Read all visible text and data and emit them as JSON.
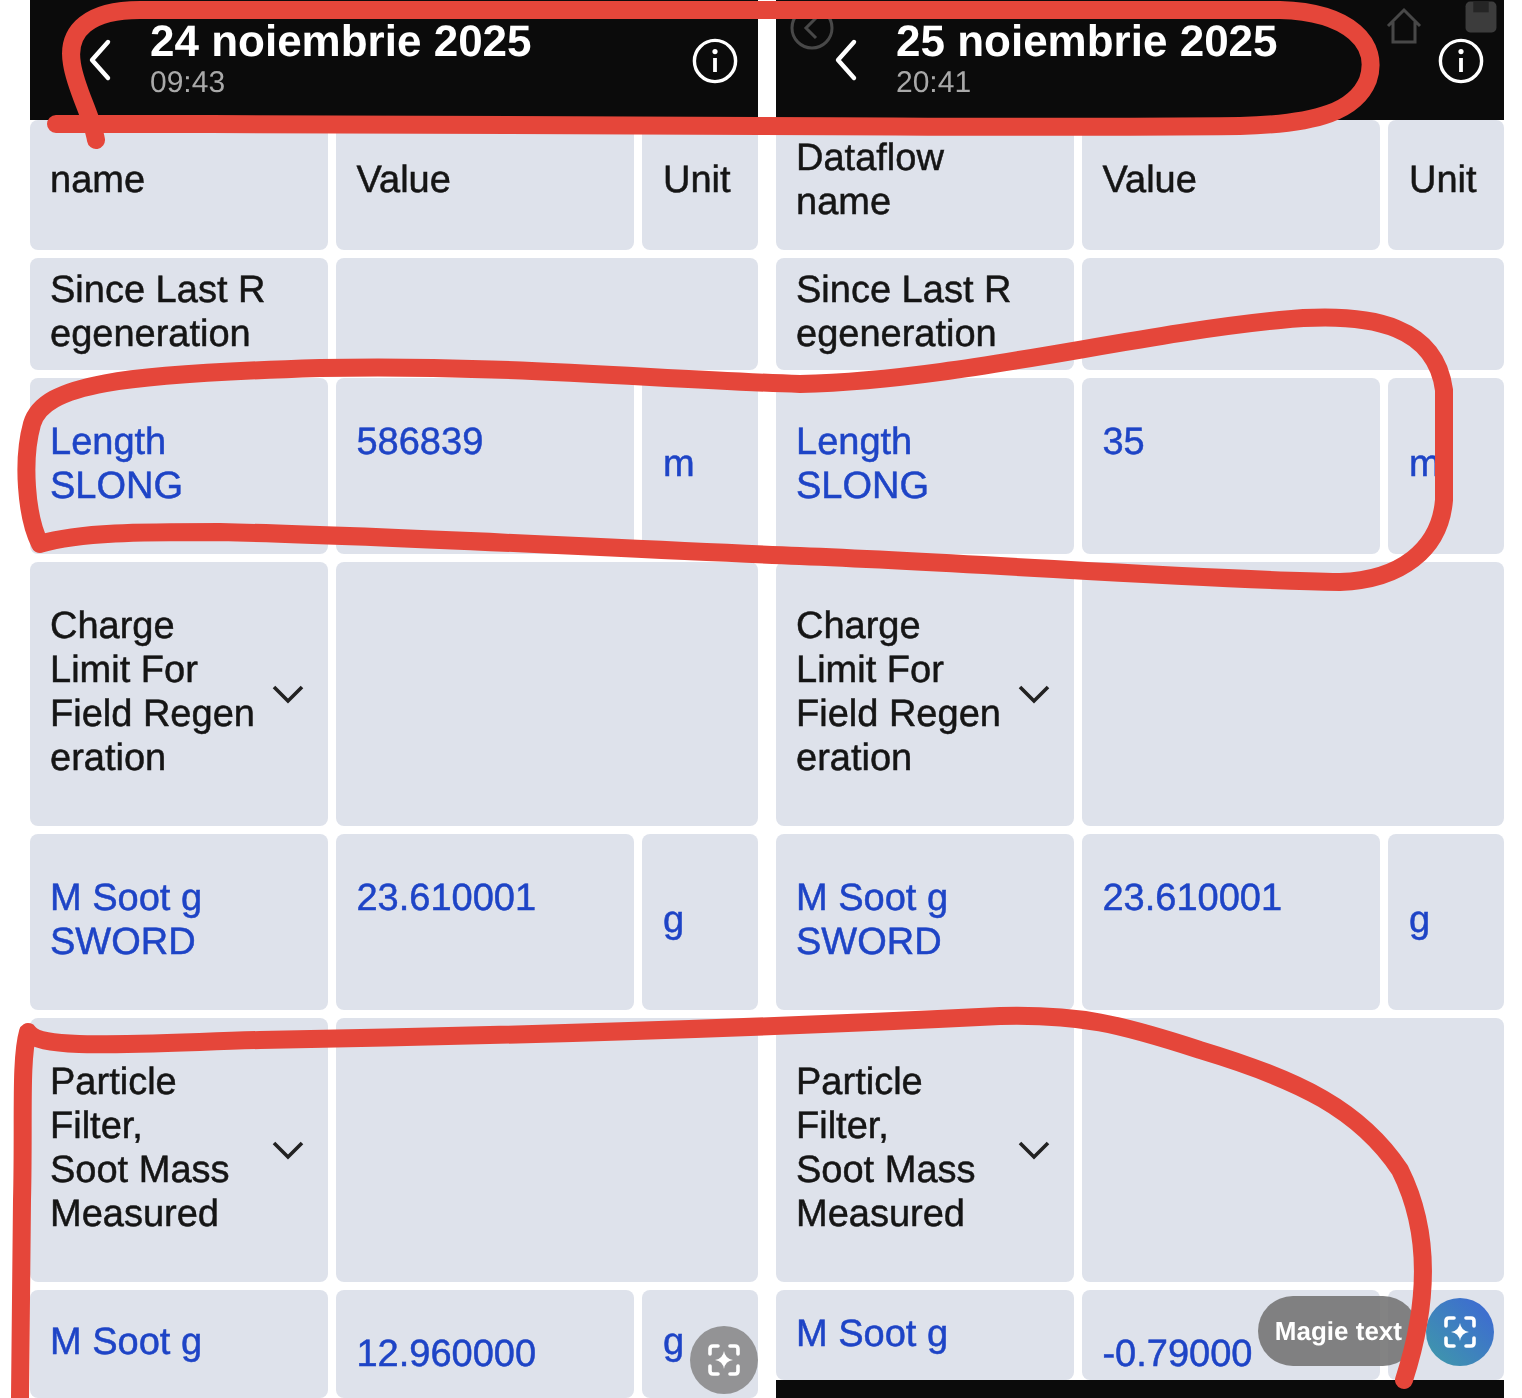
{
  "panels": [
    {
      "title": "24 noiembrie 2025",
      "time": "09:43",
      "faded_toolbar": false,
      "nav_bar": false,
      "rows": [
        {
          "kind": "heading",
          "cells": [
            "name",
            "Value",
            "Unit"
          ]
        },
        {
          "kind": "label",
          "cells": [
            "Since Last R\negeneration"
          ]
        },
        {
          "kind": "value",
          "cells": [
            "Length\nSLONG",
            "586839",
            "m"
          ]
        },
        {
          "kind": "group",
          "cells": [
            "Charge\nLimit For\nField Regen\neration"
          ]
        },
        {
          "kind": "value",
          "cells": [
            "M Soot g\nSWORD",
            "23.610001",
            "g"
          ]
        },
        {
          "kind": "group",
          "cells": [
            "Particle\nFilter,\nSoot Mass\nMeasured"
          ]
        },
        {
          "kind": "value",
          "cells": [
            "M Soot g",
            "12.960000",
            "g"
          ]
        }
      ],
      "scan_button": {
        "active": false
      }
    },
    {
      "title": "25 noiembrie 2025",
      "time": "20:41",
      "faded_toolbar": true,
      "nav_bar": true,
      "rows": [
        {
          "kind": "heading",
          "cells": [
            "Dataflow\nname",
            "Value",
            "Unit"
          ]
        },
        {
          "kind": "label",
          "cells": [
            "Since Last R\negeneration"
          ]
        },
        {
          "kind": "value",
          "cells": [
            "Length\nSLONG",
            "35",
            "m"
          ]
        },
        {
          "kind": "group",
          "cells": [
            "Charge\nLimit For\nField Regen\neration"
          ]
        },
        {
          "kind": "value",
          "cells": [
            "M Soot g\nSWORD",
            "23.610001",
            "g"
          ]
        },
        {
          "kind": "group",
          "cells": [
            "Particle\nFilter,\nSoot Mass\nMeasured"
          ]
        },
        {
          "kind": "value",
          "cells": [
            "M Soot g",
            "-0.79000"
          ]
        }
      ],
      "scan_button": {
        "active": true,
        "label": "Magie text"
      }
    }
  ]
}
